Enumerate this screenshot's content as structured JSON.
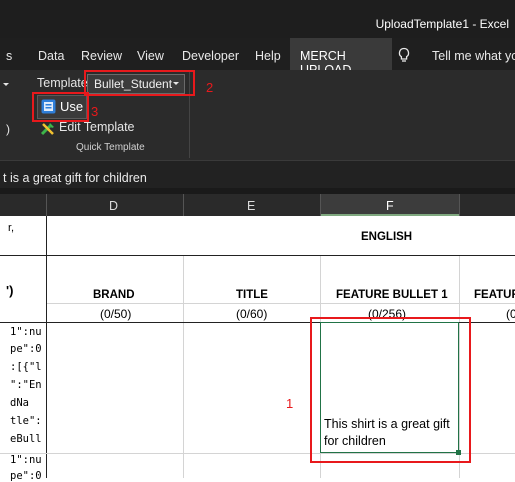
{
  "window": {
    "title": "UploadTemplate1 - Excel"
  },
  "menu": {
    "tabs": [
      {
        "label": "s"
      },
      {
        "label": "Data"
      },
      {
        "label": "Review"
      },
      {
        "label": "View"
      },
      {
        "label": "Developer"
      },
      {
        "label": "Help"
      },
      {
        "label": "MERCH UPLOAD"
      }
    ],
    "tell_me": "Tell me what you"
  },
  "ribbon": {
    "template_label": "Template",
    "template_value": "Bullet_Student",
    "use_label": "Use",
    "edit_label": "Edit Template",
    "group_label": "Quick Template",
    "left_paren": ")"
  },
  "formula_bar": {
    "text": "t is a great gift for children"
  },
  "columns": [
    "D",
    "E",
    "F"
  ],
  "sheet": {
    "left_partial_top": "r,",
    "left_partial_paren": "')",
    "left_partial_lines": [
      "1\":nu",
      "pe\":0",
      ":[{\"l",
      "\":\"En",
      "dNa",
      "tle\":",
      "eBull",
      "1\":nu",
      "pe\":0"
    ],
    "english_header": "ENGLISH",
    "headers": [
      "BRAND",
      "TITLE",
      "FEATURE BULLET 1",
      "FEATUR"
    ],
    "counts": [
      "(0/50)",
      "(0/60)",
      "(0/256)",
      "(0"
    ],
    "cell_f_line1": "This shirt is a great gift",
    "cell_f_line2": "for children"
  },
  "annotations": {
    "label_1": "1",
    "label_2": "2",
    "label_3": "3"
  },
  "colors": {
    "annotation_red": "#e8191c",
    "selection_green": "#217346"
  }
}
